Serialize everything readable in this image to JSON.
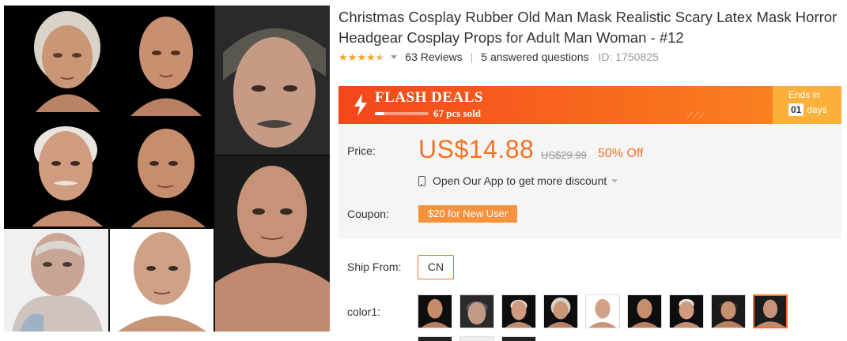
{
  "product": {
    "title": "Christmas Cosplay Rubber Old Man Mask Realistic Scary Latex Mask Horror Headgear Cosplay Props for Adult Man Woman - #12",
    "rating": 4.5,
    "reviews": "63 Reviews",
    "answered": "5 answered questions",
    "id": "ID: 1750825"
  },
  "flash": {
    "title": "FLASH DEALS",
    "sold": "67 pcs sold",
    "sold_progress": 0.18,
    "ends_label": "Ends in",
    "days_value": "01",
    "days_unit": "days"
  },
  "price": {
    "label": "Price:",
    "current": "US$14.88",
    "original": "US$29.99",
    "discount": "50% Off",
    "app_text": "Open Our App to get more discount"
  },
  "coupon": {
    "label": "Coupon:",
    "text": "$20 for New User"
  },
  "ship": {
    "label": "Ship From:",
    "option": "CN"
  },
  "colors": {
    "label": "color1:",
    "selected_index": 8
  },
  "theme": {
    "accent": "#f57224",
    "flash_start": "#f4461c",
    "flash_end": "#fa8b23",
    "ends_bg": "#fbb03b",
    "star": "#f5a623"
  }
}
